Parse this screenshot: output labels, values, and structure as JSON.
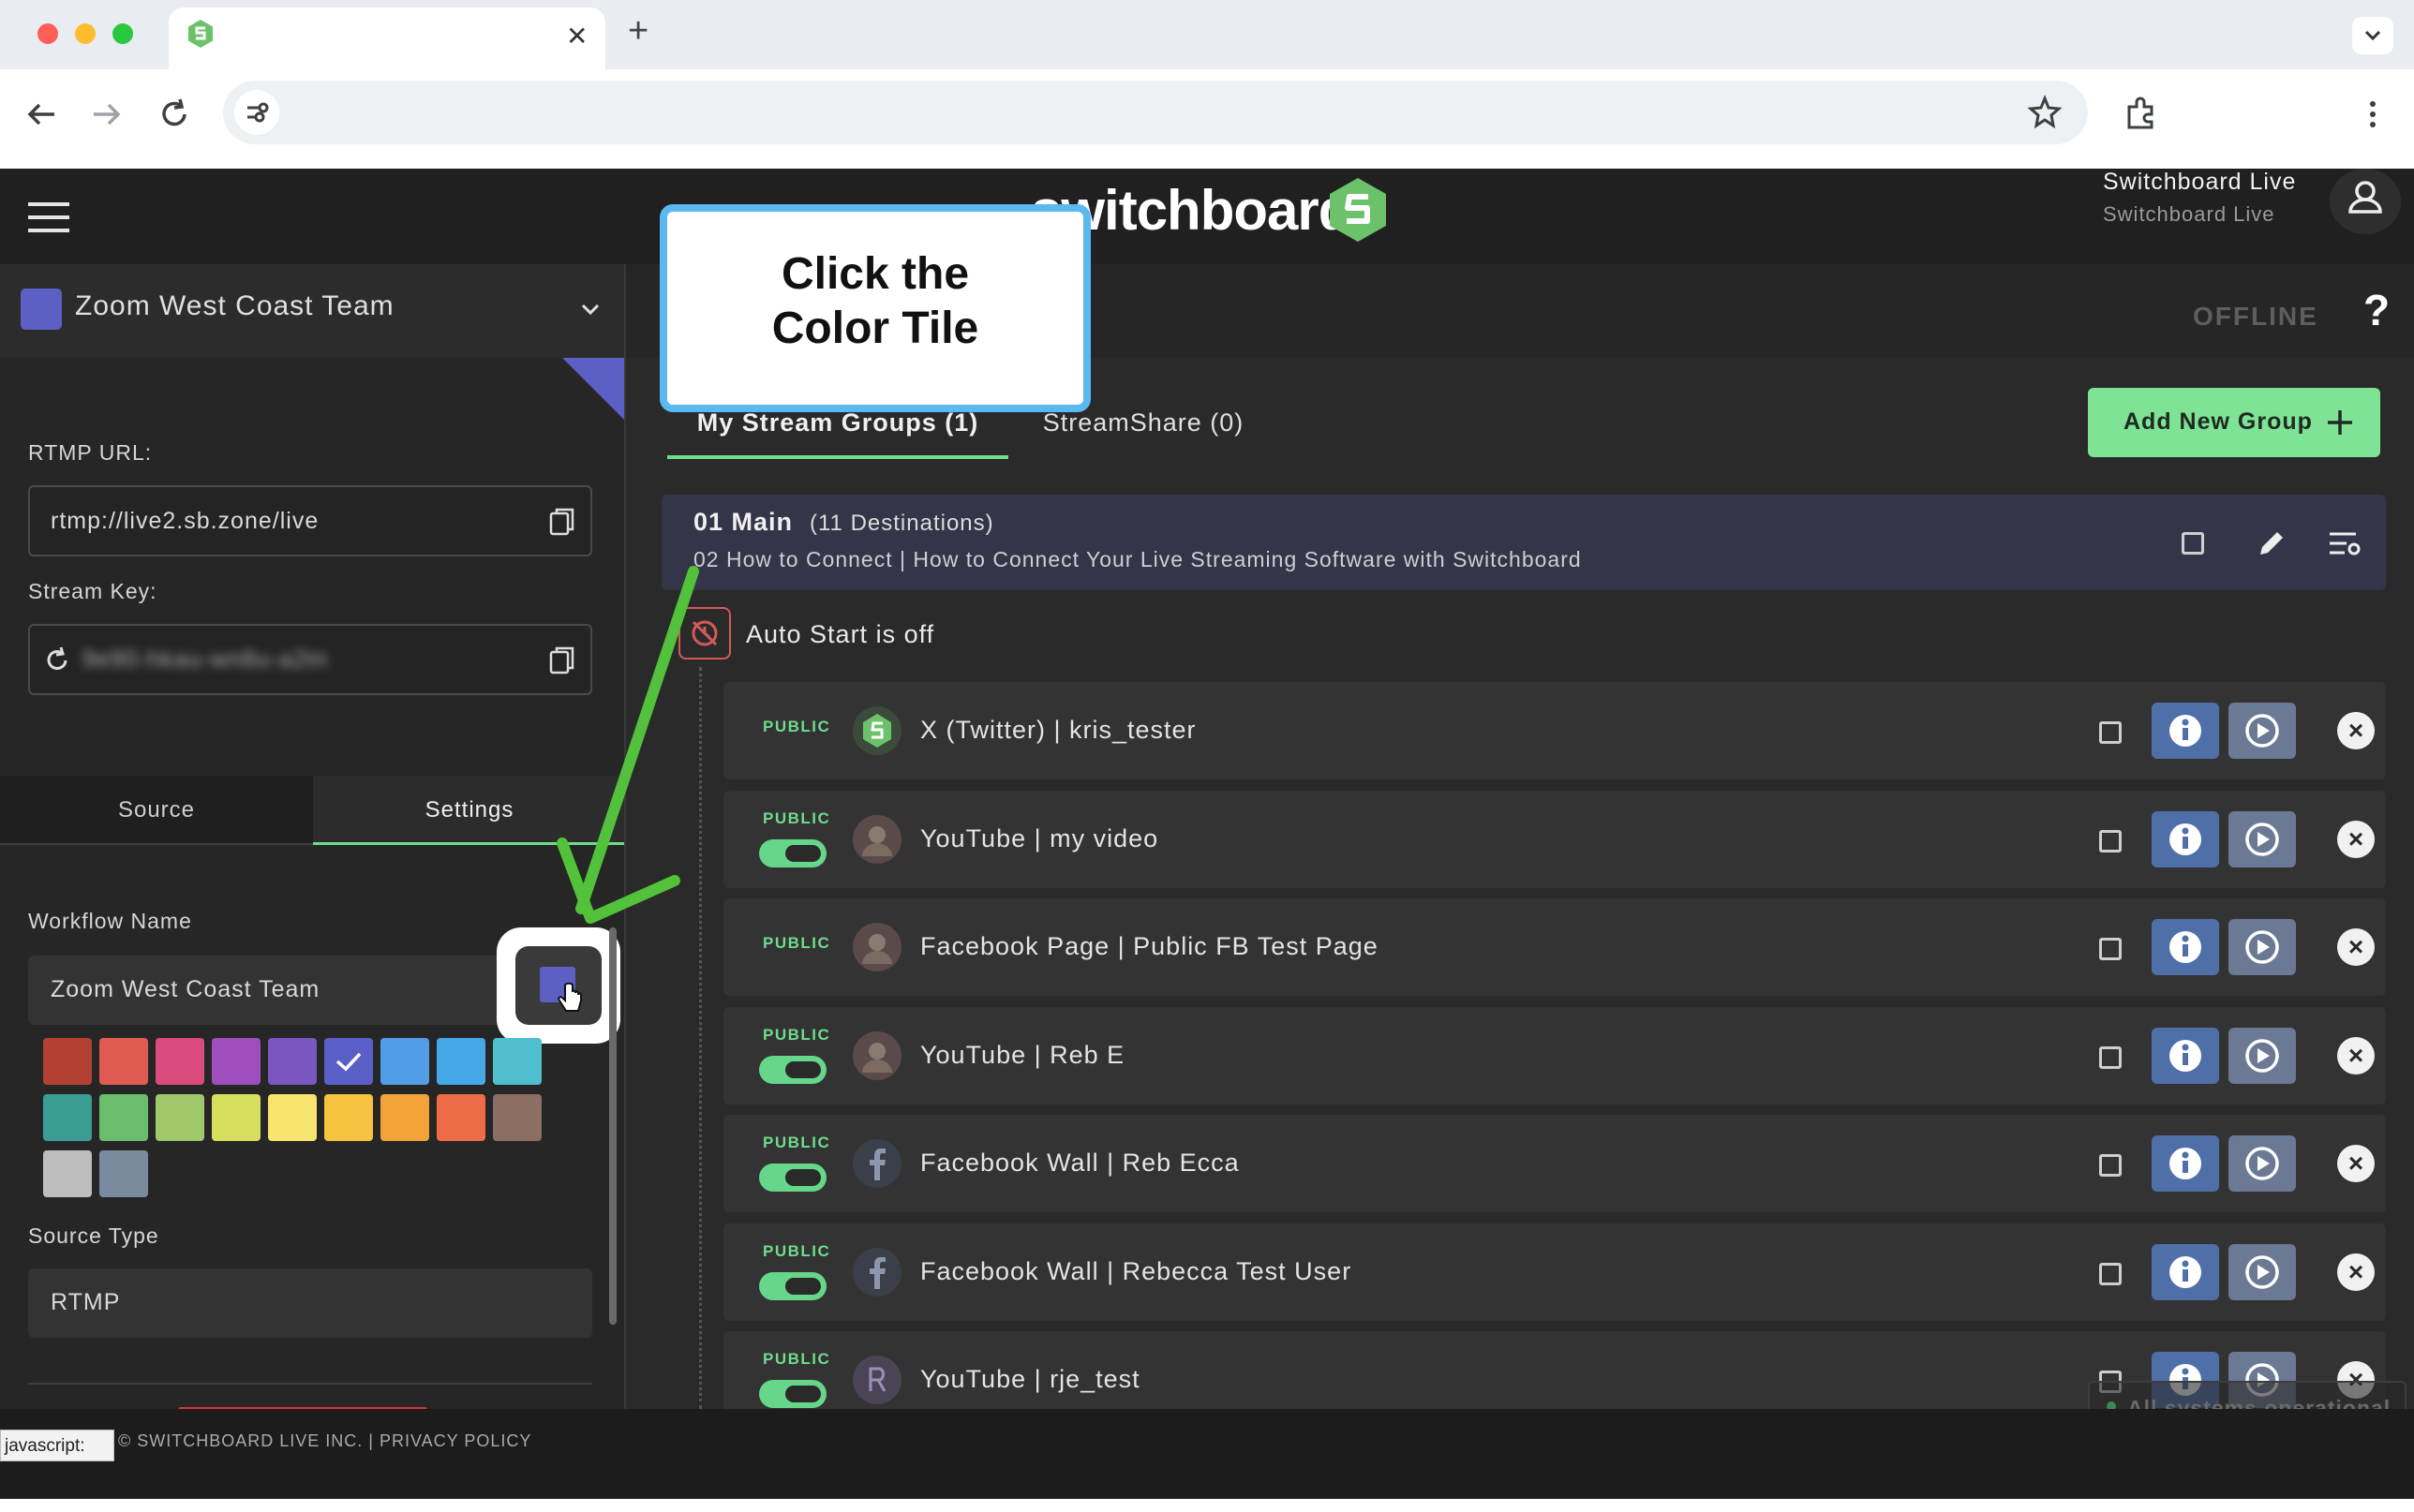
{
  "browser": {
    "address": "",
    "new_tab_glyph": "+",
    "tab_close_glyph": "✕"
  },
  "header": {
    "brand": "switchboard",
    "account_name": "Switchboard Live",
    "account_sub": "Switchboard Live"
  },
  "left": {
    "workflow_selected": "Zoom West Coast Team",
    "workflow_color": "#5c5fc4",
    "rtmp_label": "RTMP URL:",
    "rtmp_value": "rtmp://live2.sb.zone/live",
    "stream_key_label": "Stream Key:",
    "stream_key_value": "9e90-hkau-wn8u-a2tn",
    "tabs": [
      "Source",
      "Settings"
    ],
    "workflow_name_label": "Workflow Name",
    "workflow_name_value": "Zoom West Coast Team",
    "source_type_label": "Source Type",
    "source_type_value": "RTMP",
    "swatches": [
      "#b34133",
      "#df5b52",
      "#da4a7d",
      "#9e4fbd",
      "#7a56c0",
      "#5a5ec7",
      "#529ee6",
      "#47a8e8",
      "#4fbfce",
      "#3a9c93",
      "#6bbd6e",
      "#9fc86a",
      "#d6de5e",
      "#f6e46d",
      "#f5c33f",
      "#f2a33a",
      "#ee6d48",
      "#8d6e63",
      "#bdbdbd",
      "#7a8ba0"
    ],
    "selected_swatch_index": 5
  },
  "callout": {
    "line1": "Click the",
    "line2": "Color Tile"
  },
  "main": {
    "status": "OFFLINE",
    "help": "?",
    "tabs": [
      "My Stream Groups (1)",
      "StreamShare (0)"
    ],
    "add_group_label": "Add New Group",
    "group_title": "01 Main",
    "group_count": "(11 Destinations)",
    "group_subtitle": "02 How to Connect | How to Connect Your Live Streaming Software with Switchboard",
    "auto_start": "Auto Start is off",
    "destinations": [
      {
        "badge": "PUBLIC",
        "name": "X (Twitter) | kris_tester",
        "toggle": false,
        "avatar": "switchboard"
      },
      {
        "badge": "PUBLIC",
        "name": "YouTube | my video",
        "toggle": true,
        "avatar": "photo"
      },
      {
        "badge": "PUBLIC",
        "name": "Facebook Page | Public FB Test Page",
        "toggle": false,
        "avatar": "photo"
      },
      {
        "badge": "PUBLIC",
        "name": "YouTube | Reb E",
        "toggle": true,
        "avatar": "photo"
      },
      {
        "badge": "PUBLIC",
        "name": "Facebook Wall | Reb Ecca",
        "toggle": true,
        "avatar": "facebook"
      },
      {
        "badge": "PUBLIC",
        "name": "Facebook Wall | Rebecca Test User",
        "toggle": true,
        "avatar": "facebook"
      },
      {
        "badge": "PUBLIC",
        "name": "YouTube | rje_test",
        "toggle": true,
        "avatar": "R"
      }
    ],
    "systems_status": "All systems operational"
  },
  "footer": {
    "copyright": "© SWITCHBOARD LIVE INC. | PRIVACY POLICY",
    "status_link": "javascript:"
  }
}
